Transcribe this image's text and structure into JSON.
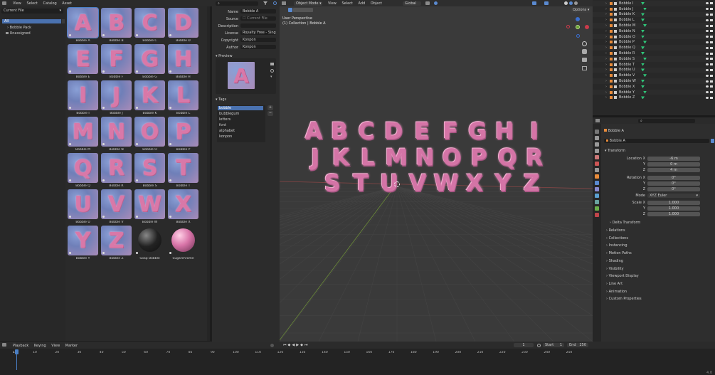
{
  "topmenu": {
    "view": "View",
    "select": "Select",
    "catalog": "Catalog",
    "asset": "Asset"
  },
  "library": {
    "source": "Current File",
    "items": [
      {
        "label": "All"
      },
      {
        "label": "Bobble Pack"
      },
      {
        "label": "Unassigned"
      }
    ]
  },
  "assets": [
    {
      "name": "Bobble A",
      "glyph": "A"
    },
    {
      "name": "Bobble B",
      "glyph": "B"
    },
    {
      "name": "Bobble C",
      "glyph": "C"
    },
    {
      "name": "Bobble D",
      "glyph": "D"
    },
    {
      "name": "Bobble E",
      "glyph": "E"
    },
    {
      "name": "Bobble F",
      "glyph": "F"
    },
    {
      "name": "Bobble G",
      "glyph": "G"
    },
    {
      "name": "Bobble H",
      "glyph": "H"
    },
    {
      "name": "Bobble I",
      "glyph": "I"
    },
    {
      "name": "Bobble J",
      "glyph": "J"
    },
    {
      "name": "Bobble K",
      "glyph": "K"
    },
    {
      "name": "Bobble L",
      "glyph": "L"
    },
    {
      "name": "Bobble M",
      "glyph": "M"
    },
    {
      "name": "Bobble N",
      "glyph": "N"
    },
    {
      "name": "Bobble O",
      "glyph": "O"
    },
    {
      "name": "Bobble P",
      "glyph": "P"
    },
    {
      "name": "Bobble Q",
      "glyph": "Q"
    },
    {
      "name": "Bobble R",
      "glyph": "R"
    },
    {
      "name": "Bobble S",
      "glyph": "S"
    },
    {
      "name": "Bobble T",
      "glyph": "T"
    },
    {
      "name": "Bobble U",
      "glyph": "U"
    },
    {
      "name": "Bobble V",
      "glyph": "V"
    },
    {
      "name": "Bobble W",
      "glyph": "W"
    },
    {
      "name": "Bobble X",
      "glyph": "X"
    },
    {
      "name": "Bobble Y",
      "glyph": "Y"
    },
    {
      "name": "Bobble Z",
      "glyph": "Z"
    },
    {
      "name": "Soap Bobble",
      "glyph": ""
    },
    {
      "name": "Sugarchrome",
      "glyph": ""
    }
  ],
  "details": {
    "name_label": "Name",
    "name": "Bobble A",
    "source_label": "Source",
    "source": "Current File",
    "description_label": "Description",
    "license_label": "License",
    "license": "Royalty Free - Singl...",
    "copyright_label": "Copyright",
    "copyright": "Konpon",
    "author_label": "Author",
    "author": "Konpon",
    "preview_label": "Preview",
    "preview_glyph": "A",
    "tags_label": "Tags",
    "tags": [
      "bobble",
      "bubblegum",
      "letters",
      "font",
      "alphabet",
      "konpon"
    ]
  },
  "viewport": {
    "mode": "Object Mode",
    "menus": [
      "View",
      "Select",
      "Add",
      "Object"
    ],
    "transform": "Global",
    "options": "Options",
    "perspective": "User Perspective",
    "collection": "(1) Collection | Bobble A",
    "rows": [
      [
        "A",
        "B",
        "C",
        "D",
        "E",
        "F",
        "G",
        "H",
        "I"
      ],
      [
        "J",
        "K",
        "L",
        "M",
        "N",
        "O",
        "P",
        "Q",
        "R"
      ],
      [
        "S",
        "T",
        "U",
        "V",
        "W",
        "X",
        "Y",
        "Z"
      ]
    ]
  },
  "outliner": {
    "items": [
      "Bobble I",
      "Bobble J",
      "Bobble K",
      "Bobble L",
      "Bobble M",
      "Bobble N",
      "Bobble O",
      "Bobble P",
      "Bobble Q",
      "Bobble R",
      "Bobble S",
      "Bobble T",
      "Bobble U",
      "Bobble V",
      "Bobble W",
      "Bobble X",
      "Bobble Y",
      "Bobble Z"
    ]
  },
  "properties": {
    "object": "Bobble A",
    "object_field": "Bobble A",
    "transform": "Transform",
    "location_label": "Location X",
    "loc_x": "-6 m",
    "loc_y": "0 m",
    "loc_z": "4 m",
    "rotation_label": "Rotation X",
    "rot_x": "0°",
    "rot_y": "0°",
    "rot_z": "0°",
    "mode_label": "Mode",
    "mode": "XYZ Euler",
    "scale_label": "Scale X",
    "sc_x": "1.000",
    "sc_y": "1.000",
    "sc_z": "1.000",
    "y": "Y",
    "z": "Z",
    "delta": "Delta Transform",
    "sections": [
      "Relations",
      "Collections",
      "Instancing",
      "Motion Paths",
      "Shading",
      "Visibility",
      "Viewport Display",
      "Line Art",
      "Animation",
      "Custom Properties"
    ]
  },
  "timeline": {
    "menus": [
      "Playback",
      "Keying",
      "View",
      "Marker"
    ],
    "current_frame": "1",
    "start_label": "Start",
    "start": "1",
    "end_label": "End",
    "end": "250",
    "ticks": [
      "1",
      "10",
      "20",
      "30",
      "40",
      "50",
      "60",
      "70",
      "80",
      "90",
      "100",
      "110",
      "120",
      "130",
      "140",
      "150",
      "160",
      "170",
      "180",
      "190",
      "200",
      "210",
      "220",
      "230",
      "240",
      "250"
    ]
  },
  "status": {
    "version": "4.0"
  }
}
